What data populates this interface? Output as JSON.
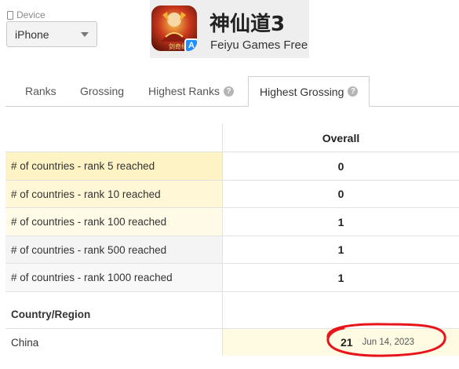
{
  "device": {
    "label": "Device",
    "selected": "iPhone"
  },
  "app": {
    "title": "神仙道3",
    "developer": "Feiyu Games Free",
    "icon_caption": "剑奇缘",
    "store_badge_icon": "app-store-icon"
  },
  "tabs": [
    {
      "label": "Ranks",
      "help": false
    },
    {
      "label": "Grossing",
      "help": false
    },
    {
      "label": "Highest Ranks",
      "help": true
    },
    {
      "label": "Highest Grossing",
      "help": true,
      "active": true
    }
  ],
  "table": {
    "column_header": "Overall",
    "rows": [
      {
        "label": "# of countries - rank 5 reached",
        "value": "0"
      },
      {
        "label": "# of countries - rank 10 reached",
        "value": "0"
      },
      {
        "label": "# of countries - rank 100 reached",
        "value": "1"
      },
      {
        "label": "# of countries - rank 500 reached",
        "value": "1"
      },
      {
        "label": "# of countries - rank 1000 reached",
        "value": "1"
      }
    ],
    "section_header": "Country/Region",
    "country_rows": [
      {
        "country": "China",
        "rank": "21",
        "date": "Jun 14, 2023"
      }
    ]
  },
  "colors": {
    "annotation": "#e8141c",
    "highlight_yellow": "#fdf3c4",
    "badge_blue": "#1e90ff"
  }
}
